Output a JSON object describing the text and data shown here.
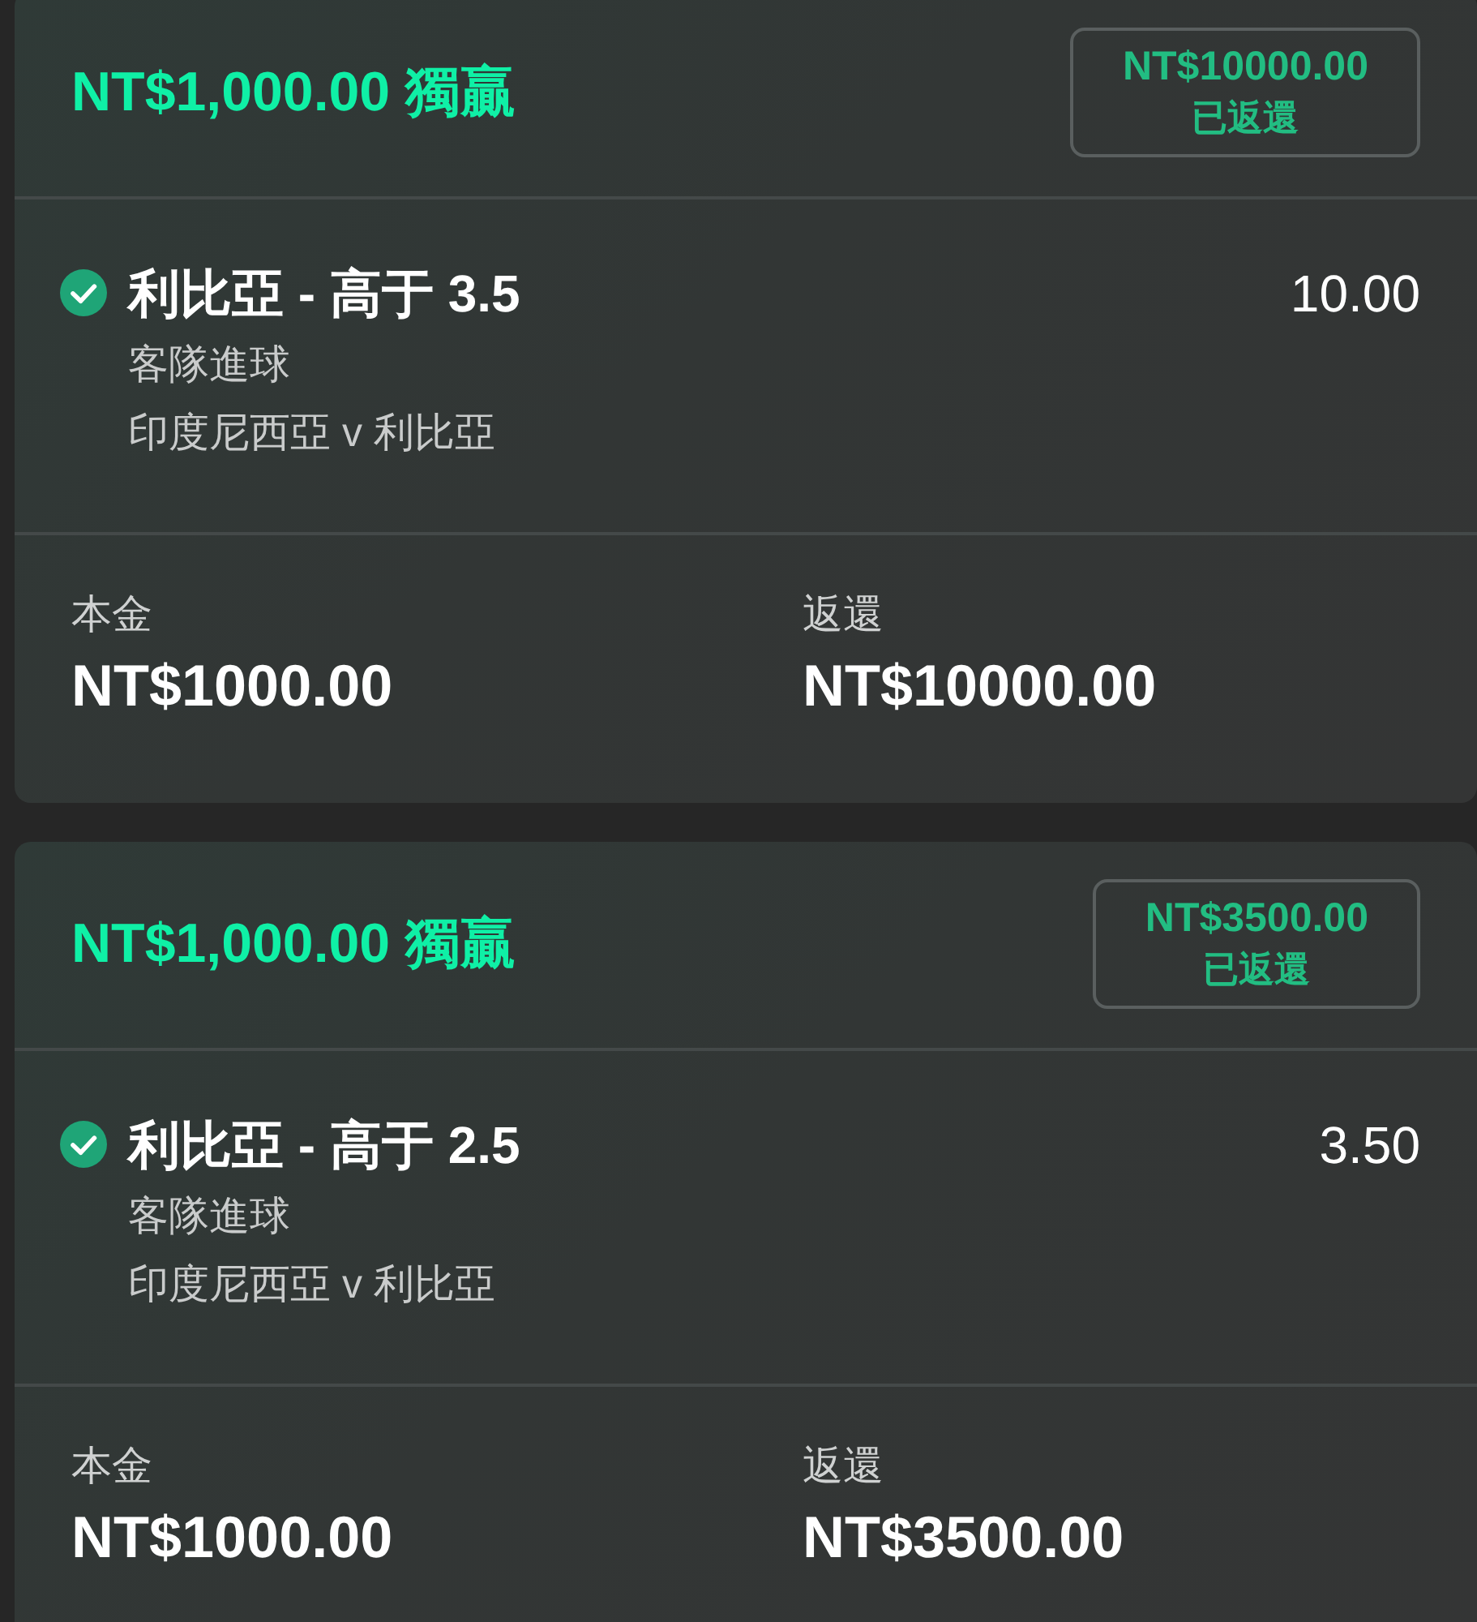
{
  "bets": [
    {
      "header": {
        "title": "NT$1,000.00 獨贏",
        "payout_badge": {
          "amount": "NT$10000.00",
          "status": "已返還"
        }
      },
      "selection": {
        "won": true,
        "title": "利比亞 - 高于 3.5",
        "odds": "10.00",
        "market": "客隊進球",
        "event": "印度尼西亞 v 利比亞"
      },
      "summary": [
        {
          "label": "本金",
          "value": "NT$1000.00"
        },
        {
          "label": "返還",
          "value": "NT$10000.00"
        }
      ]
    },
    {
      "header": {
        "title": "NT$1,000.00 獨贏",
        "payout_badge": {
          "amount": "NT$3500.00",
          "status": "已返還"
        }
      },
      "selection": {
        "won": true,
        "title": "利比亞 - 高于 2.5",
        "odds": "3.50",
        "market": "客隊進球",
        "event": "印度尼西亞 v 利比亞"
      },
      "summary": [
        {
          "label": "本金",
          "value": "NT$1000.00"
        },
        {
          "label": "返還",
          "value": "NT$3500.00"
        }
      ]
    }
  ]
}
